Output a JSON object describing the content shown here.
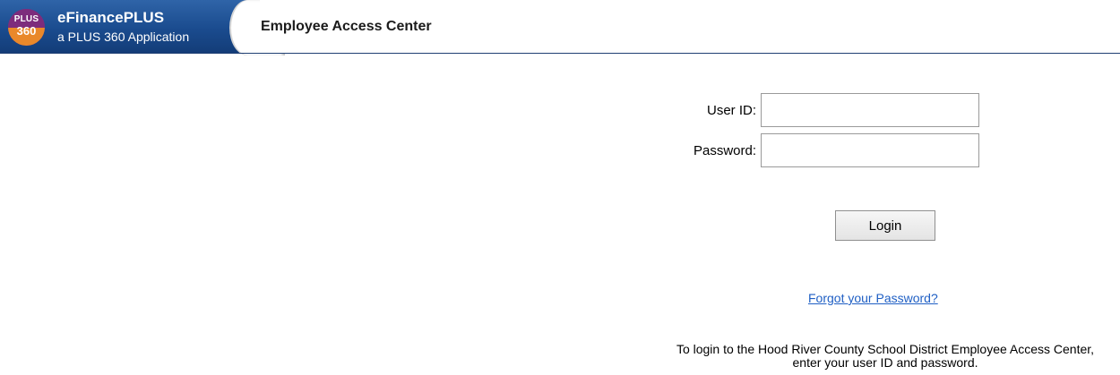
{
  "header": {
    "logo_top": "PLUS",
    "logo_bottom": "360",
    "product_name": "eFinancePLUS",
    "product_subtitle": "a PLUS 360 Application",
    "page_title": "Employee Access Center",
    "colors": {
      "brand_bar": "#1a4b8e",
      "logo_purple": "#7d2c7c",
      "logo_orange": "#e9882a",
      "divider": "#1f3f73"
    }
  },
  "login_form": {
    "user_id_label": "User ID:",
    "user_id_value": "",
    "password_label": "Password:",
    "password_value": "",
    "login_button_label": "Login",
    "forgot_link_text": "Forgot your Password?",
    "link_color": "#1f5fc4"
  },
  "instructions": {
    "text": "To login to the Hood River County School District Employee Access Center, enter your user ID and password."
  }
}
